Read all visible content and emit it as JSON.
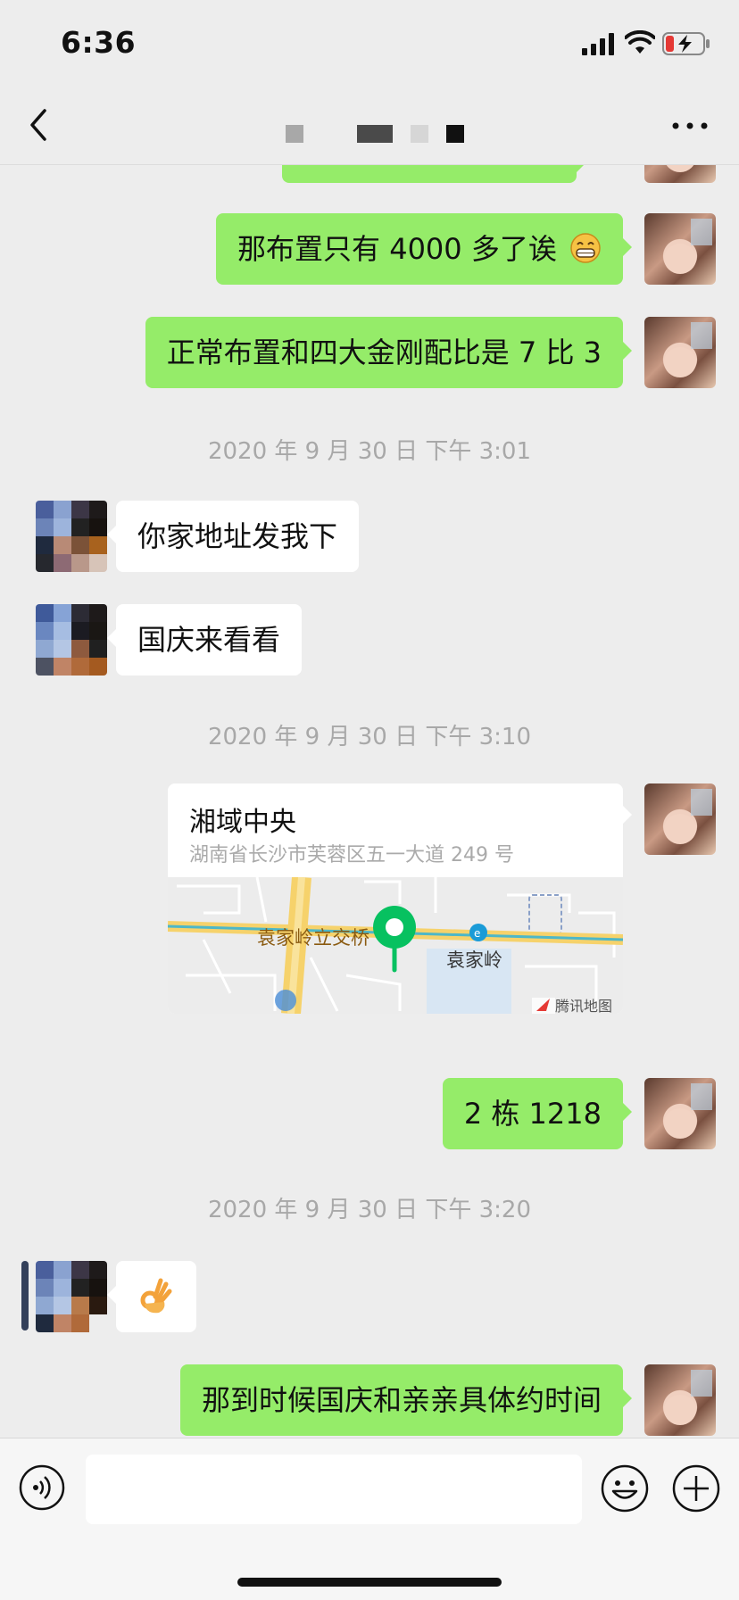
{
  "status": {
    "time": "6:36"
  },
  "nav": {
    "title_redacted": true
  },
  "messages": [
    {
      "text": "那布置只有 4000 多了诶"
    },
    {
      "text": "正常布置和四大金刚配比是 7 比 3"
    },
    {
      "text": "你家地址发我下"
    },
    {
      "text": "国庆来看看"
    },
    {
      "text": "2 栋 1218"
    },
    {
      "text": "那到时候国庆和亲亲具体约时间"
    }
  ],
  "timestamps": [
    "2020 年 9 月 30 日 下午 3:01",
    "2020 年 9 月 30 日 下午 3:10",
    "2020 年 9 月 30 日 下午 3:20"
  ],
  "location": {
    "title": "湘域中央",
    "address": "湖南省长沙市芙蓉区五一大道 249 号",
    "map_label_1": "袁家岭立交桥",
    "map_label_2": "袁家岭",
    "map_brand": "腾讯地图"
  },
  "colors": {
    "bubble_self": "#95ec69",
    "bubble_other": "#ffffff",
    "background": "#ededed",
    "pin": "#07c160"
  },
  "icons": [
    "signal-icon",
    "wifi-icon",
    "battery-icon",
    "back-icon",
    "more-icon",
    "voice-icon",
    "emoji-icon",
    "plus-icon",
    "grin-emoji",
    "ok-hand-emoji",
    "map-pin-icon"
  ]
}
